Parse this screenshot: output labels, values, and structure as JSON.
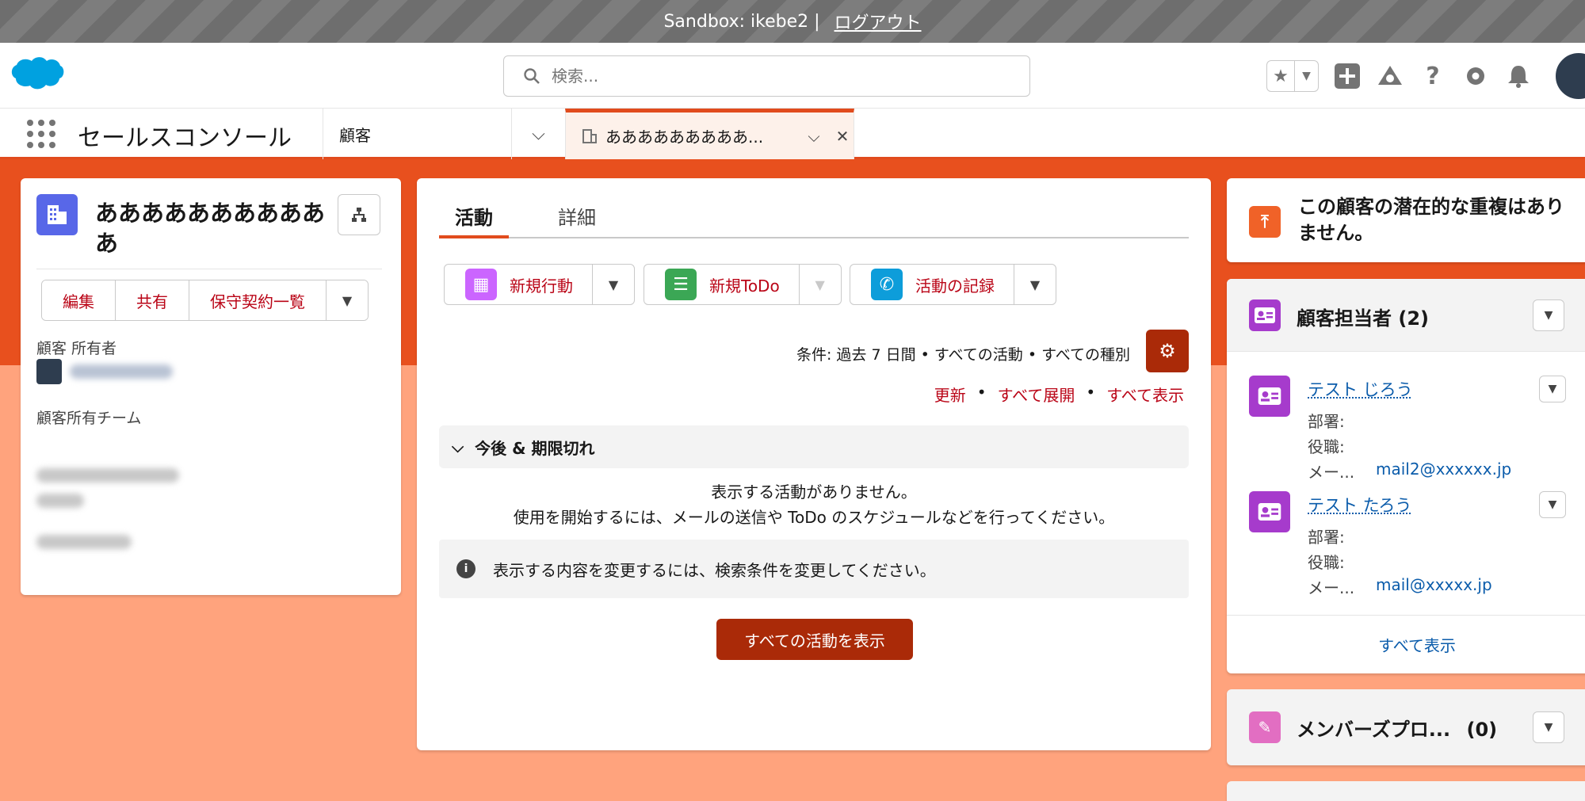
{
  "sandbox": {
    "label": "Sandbox: ikebe2 |",
    "logout": "ログアウト"
  },
  "header": {
    "search_placeholder": "検索...",
    "icons": [
      "star-icon",
      "chevron-down-icon",
      "plus-icon",
      "trailhead-icon",
      "help-icon",
      "gear-icon",
      "bell-icon",
      "avatar"
    ]
  },
  "app_nav": {
    "app_name": "セールスコンソール",
    "nav_item": "顧客",
    "workspace_tab": "あああああああああ..."
  },
  "account": {
    "name": "あああああああああああ",
    "actions": [
      "編集",
      "共有",
      "保守契約一覧"
    ],
    "owner_label": "顧客 所有者",
    "team_label": "顧客所有チーム"
  },
  "activity": {
    "tabs": [
      "活動",
      "詳細"
    ],
    "publishers": [
      "新規行動",
      "新規ToDo",
      "活動の記録"
    ],
    "filter_text": "条件: 過去 7 日間 • すべての活動 • すべての種別",
    "links": [
      "更新",
      "すべて展開",
      "すべて表示"
    ],
    "link_separator": "•",
    "section_title": "今後 & 期限切れ",
    "empty_line1": "表示する活動がありません。",
    "empty_line2": "使用を開始するには、メールの送信や ToDo のスケジュールなどを行ってください。",
    "info_text": "表示する内容を変更するには、検索条件を変更してください。",
    "show_all_button": "すべての活動を表示"
  },
  "duplicates": {
    "text": "この顧客の潜在的な重複はありません。"
  },
  "contacts": {
    "title": "顧客担当者 (2)",
    "field_department": "部署:",
    "field_title": "役職:",
    "field_email": "メー...",
    "items": [
      {
        "name": "テスト じろう",
        "email": "mail2@xxxxxx.jp"
      },
      {
        "name": "テスト たろう",
        "email": "mail@xxxxx.jp"
      }
    ],
    "view_all": "すべて表示"
  },
  "members": {
    "title": "メンバーズプロ...",
    "count": "(0)"
  },
  "colors": {
    "brand": "#e14b1d",
    "button": "#aa2a08",
    "link": "#0b5cab",
    "background": "#ffa37d"
  }
}
